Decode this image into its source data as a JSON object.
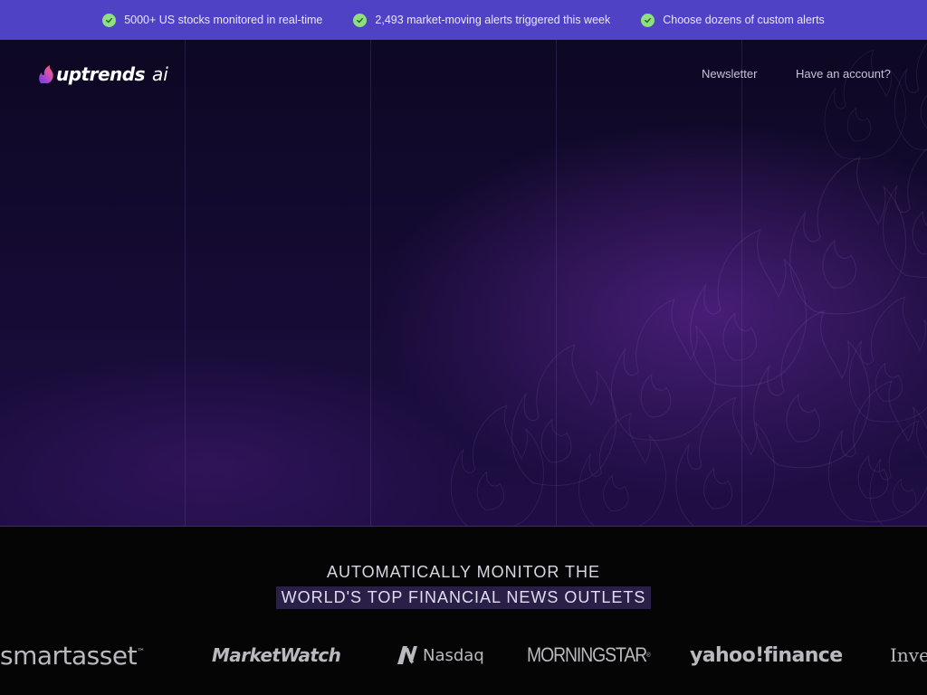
{
  "topbar": {
    "items": [
      {
        "text": "5000+ US stocks monitored in real-time",
        "icon": "check-circle-icon"
      },
      {
        "text": "2,493 market-moving alerts triggered this week",
        "icon": "check-circle-icon"
      },
      {
        "text": "Choose dozens of custom alerts",
        "icon": "check-circle-icon"
      }
    ],
    "background": "#4f42c4",
    "check_color": "#8ee07f"
  },
  "nav": {
    "logo_text": "uptrends",
    "logo_suffix": "ai",
    "links": [
      {
        "label": "Newsletter"
      },
      {
        "label": "Have an account?"
      }
    ]
  },
  "press": {
    "line1": "AUTOMATICALLY MONITOR THE",
    "line2": "WORLD'S TOP FINANCIAL NEWS OUTLETS",
    "outlets": [
      {
        "name": "smartasset",
        "mark": "™"
      },
      {
        "name": "MarketWatch"
      },
      {
        "name": "Nasdaq"
      },
      {
        "name": "MORNINGSTAR",
        "mark": "®"
      },
      {
        "name": "yahoo!finance"
      },
      {
        "name": "Inves"
      }
    ]
  },
  "colors": {
    "accent": "#4f42c4",
    "hero_glow": "#58248c",
    "footer_bg": "#050505"
  }
}
